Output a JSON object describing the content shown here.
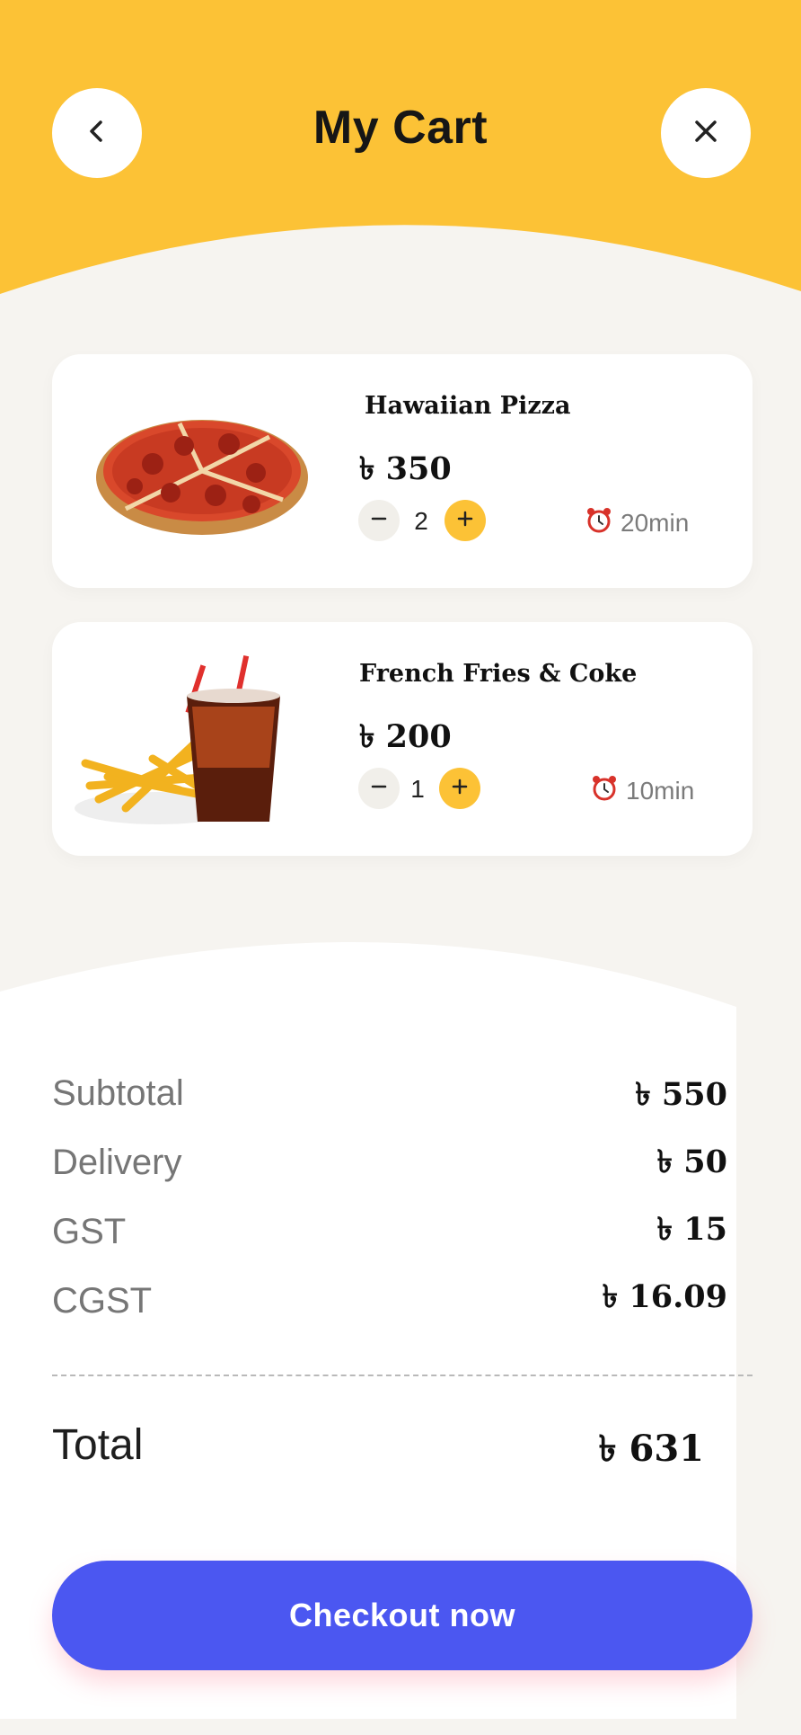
{
  "colors": {
    "header_yellow": "#fcc236",
    "background": "#f6f4f0",
    "card": "#ffffff",
    "accent_plus": "#fcc236",
    "checkout_blue": "#4b57f1"
  },
  "header": {
    "title": "My Cart",
    "back_icon": "chevron-left-icon",
    "close_icon": "close-icon"
  },
  "cart": {
    "items": [
      {
        "name": "Hawaiian Pizza",
        "price": "৳ 350",
        "quantity": "2",
        "eta": "20min",
        "image": "pepperoni-pizza-image"
      },
      {
        "name": "French Fries & Coke",
        "price": "৳ 200",
        "quantity": "1",
        "eta": "10min",
        "image": "fries-and-coke-image"
      }
    ]
  },
  "summary": {
    "rows": [
      {
        "label": "Subtotal",
        "value": "৳ 550"
      },
      {
        "label": "Delivery",
        "value": "৳ 50"
      },
      {
        "label": "GST",
        "value": "৳ 15"
      },
      {
        "label": "CGST",
        "value": "৳ 16.09"
      }
    ],
    "total_label": "Total",
    "total_value": "৳ 631"
  },
  "checkout": {
    "label": "Checkout now"
  }
}
